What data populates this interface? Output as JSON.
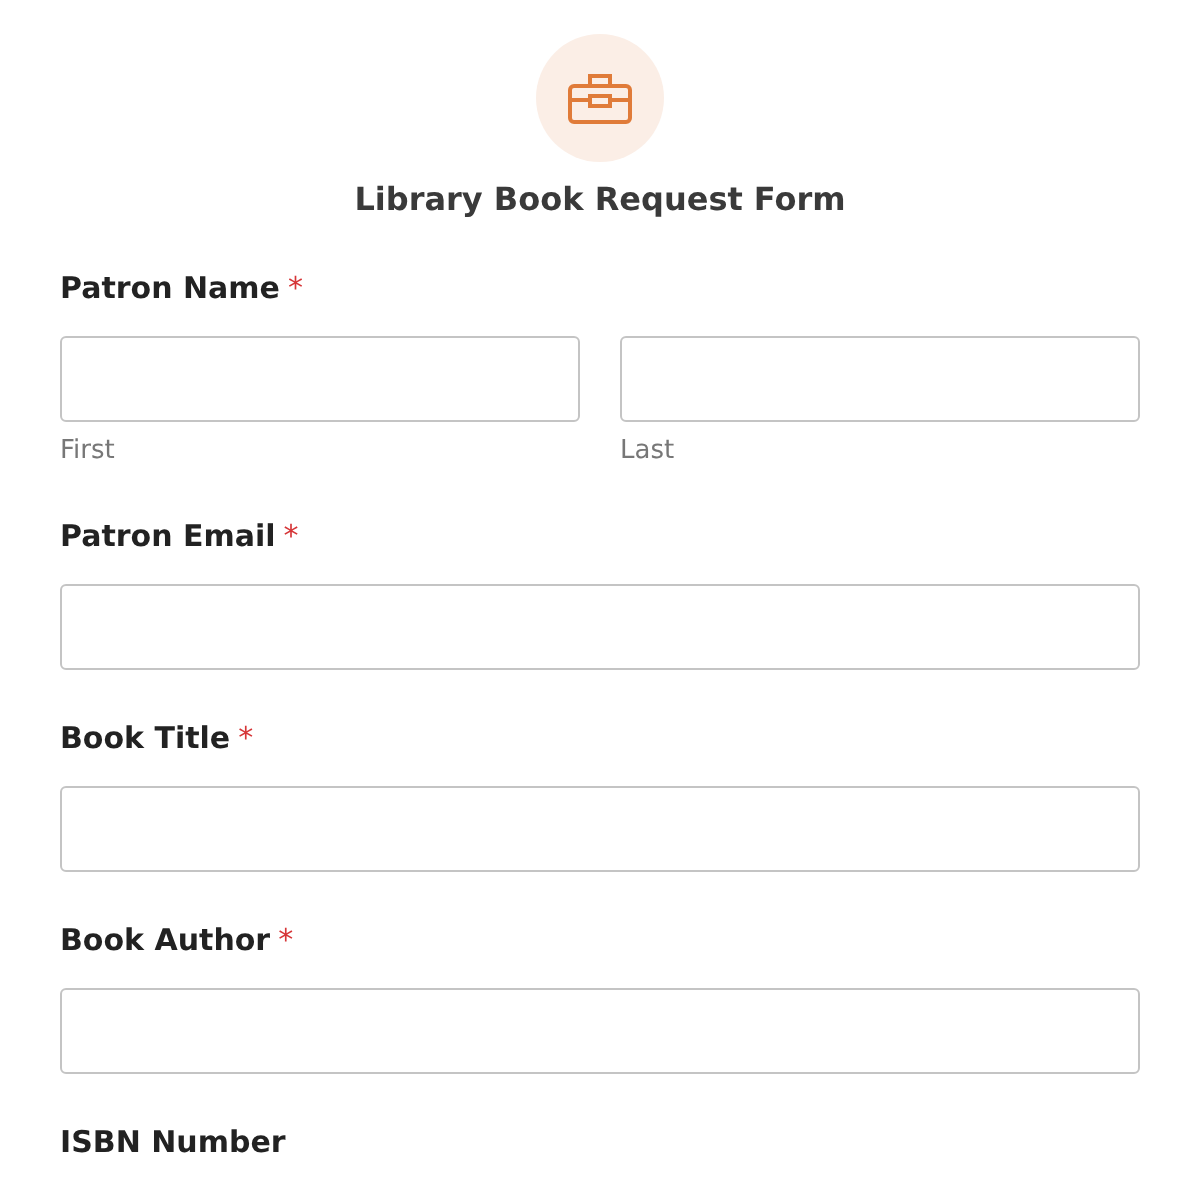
{
  "form": {
    "title": "Library Book Request Form"
  },
  "fields": [
    {
      "kind": "name",
      "label": "Patron Name",
      "required": true,
      "sublabels": [
        "First",
        "Last"
      ]
    },
    {
      "kind": "text",
      "label": "Patron Email",
      "required": true
    },
    {
      "kind": "text",
      "label": "Book Title",
      "required": true
    },
    {
      "kind": "text",
      "label": "Book Author",
      "required": true
    },
    {
      "kind": "label_only",
      "label": "ISBN Number",
      "required": false
    }
  ],
  "required_mark": "*"
}
